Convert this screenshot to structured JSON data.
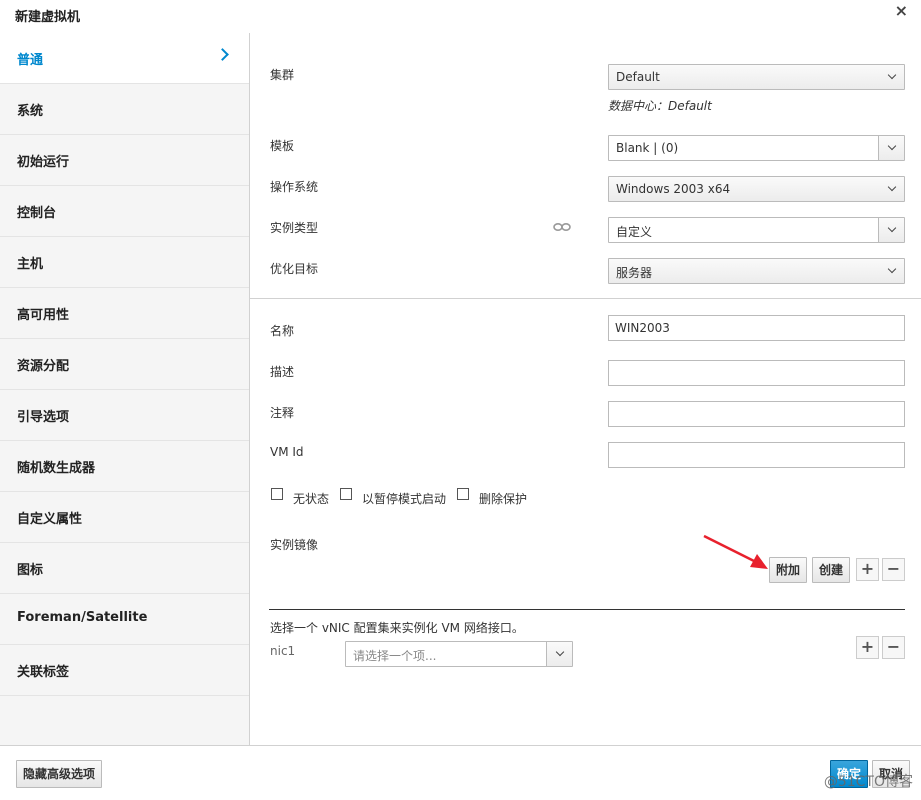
{
  "dialog": {
    "title": "新建虚拟机"
  },
  "sidebar": {
    "items": [
      {
        "label": "普通"
      },
      {
        "label": "系统"
      },
      {
        "label": "初始运行"
      },
      {
        "label": "控制台"
      },
      {
        "label": "主机"
      },
      {
        "label": "高可用性"
      },
      {
        "label": "资源分配"
      },
      {
        "label": "引导选项"
      },
      {
        "label": "随机数生成器"
      },
      {
        "label": "自定义属性"
      },
      {
        "label": "图标"
      },
      {
        "label": "Foreman/Satellite"
      },
      {
        "label": "关联标签"
      }
    ]
  },
  "form": {
    "cluster": {
      "label": "集群",
      "value": "Default",
      "datacenter_hint": "数据中心：Default"
    },
    "template": {
      "label": "模板",
      "value": "Blank | (0)"
    },
    "os": {
      "label": "操作系统",
      "value": "Windows 2003 x64"
    },
    "instance_type": {
      "label": "实例类型",
      "value": "自定义"
    },
    "optimized_for": {
      "label": "优化目标",
      "value": "服务器"
    },
    "name": {
      "label": "名称",
      "value": "WIN2003"
    },
    "description": {
      "label": "描述",
      "value": ""
    },
    "comment": {
      "label": "注释",
      "value": ""
    },
    "vm_id": {
      "label": "VM Id",
      "value": ""
    },
    "checkboxes": {
      "stateless": "无状态",
      "start_paused": "以暂停模式启动",
      "delete_protection": "删除保护"
    },
    "instance_images": {
      "label": "实例镜像",
      "attach": "附加",
      "create": "创建",
      "plus": "+",
      "minus": "−"
    },
    "nic": {
      "hint": "选择一个 vNIC 配置集来实例化 VM 网络接口。",
      "label": "nic1",
      "placeholder": "请选择一个项...",
      "plus": "+",
      "minus": "−"
    }
  },
  "footer": {
    "advanced": "隐藏高级选项",
    "ok": "确定",
    "cancel": "取消"
  },
  "watermark": "@51CTO博客",
  "colors": {
    "accent": "#0088ce",
    "annotation_arrow": "#e8212d"
  }
}
